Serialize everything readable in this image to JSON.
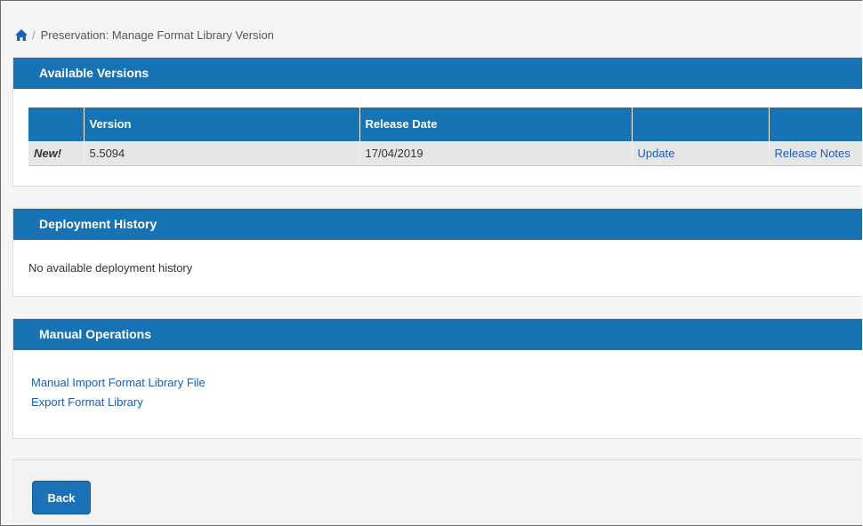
{
  "breadcrumb": {
    "home_icon": "home-icon",
    "separator": "/",
    "current": "Preservation: Manage Format Library Version"
  },
  "available_versions": {
    "title": "Available Versions",
    "columns": [
      "",
      "Version",
      "Release Date",
      "",
      ""
    ],
    "rows": [
      {
        "flag": "New!",
        "version": "5.5094",
        "release_date": "17/04/2019",
        "action": "Update",
        "notes": "Release Notes"
      }
    ]
  },
  "deployment_history": {
    "title": "Deployment History",
    "empty_text": "No available deployment history"
  },
  "manual_operations": {
    "title": "Manual Operations",
    "links": [
      "Manual Import Format Library File",
      "Export Format Library"
    ]
  },
  "footer": {
    "back_label": "Back"
  },
  "colors": {
    "header_blue": "#1873b4",
    "link_blue": "#1a5fb4"
  }
}
